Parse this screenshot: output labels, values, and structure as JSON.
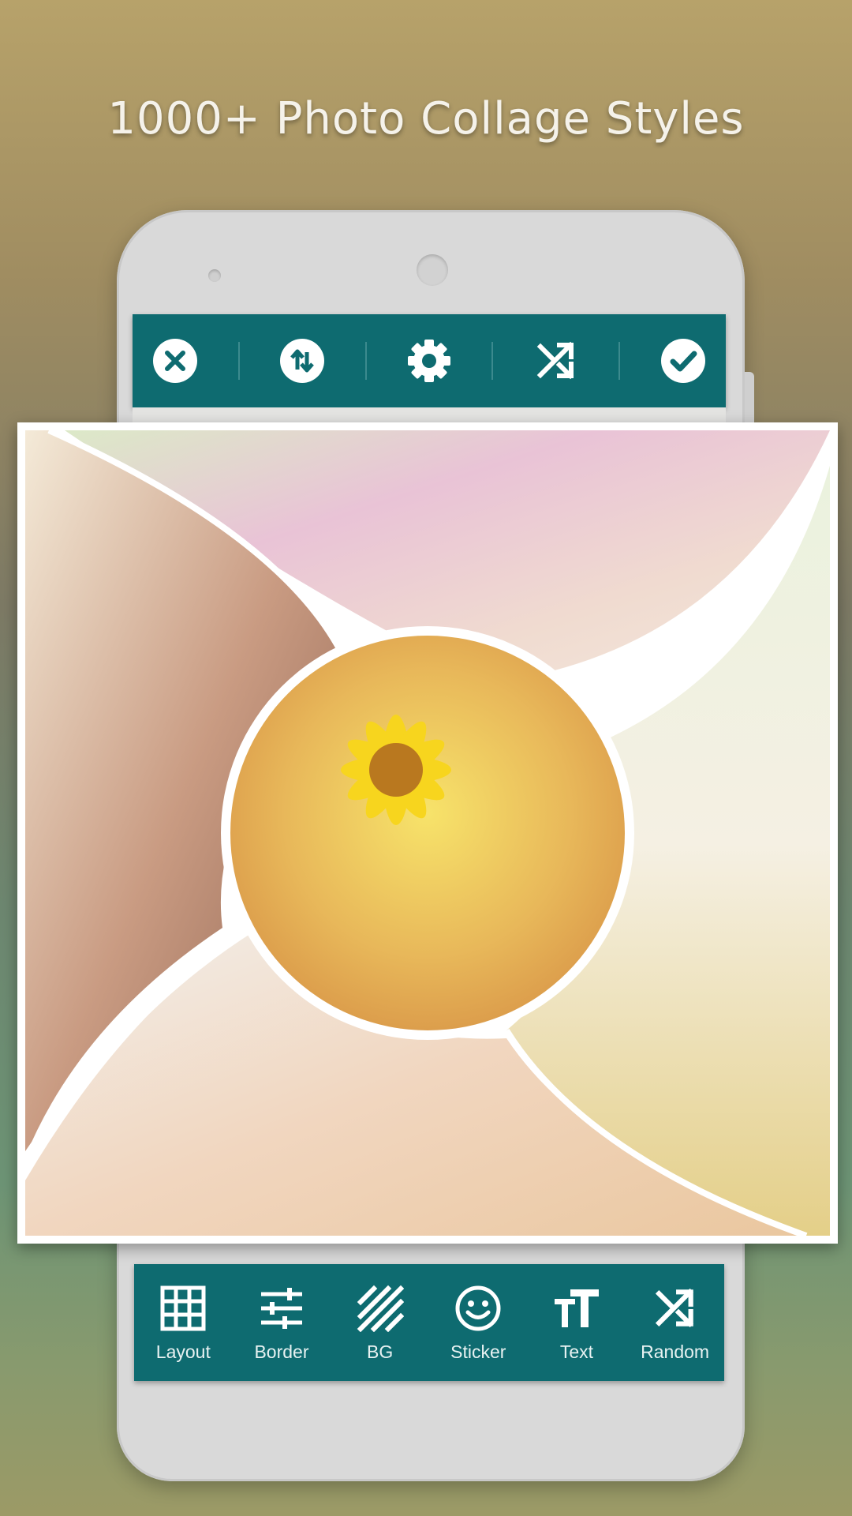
{
  "headline": "1000+ Photo Collage Styles",
  "colors": {
    "toolbar": "#0e6b70",
    "phone_body": "#d9d9d9",
    "frame": "#ffffff"
  },
  "top_toolbar": [
    {
      "icon": "close-circle-icon"
    },
    {
      "icon": "swap-vertical-icon"
    },
    {
      "icon": "gear-icon"
    },
    {
      "icon": "shuffle-icon"
    },
    {
      "icon": "check-circle-icon"
    }
  ],
  "collage_photos": [
    {
      "icon": "photo-girl-flower-crown"
    },
    {
      "icon": "photo-girl-pink-blossoms"
    },
    {
      "icon": "photo-girl-meadow"
    },
    {
      "icon": "photo-girl-blonde-closeup"
    },
    {
      "icon": "photo-girl-sunflower"
    }
  ],
  "bottom_toolbar": [
    {
      "label": "Layout",
      "icon": "grid-icon"
    },
    {
      "label": "Border",
      "icon": "sliders-icon"
    },
    {
      "label": "BG",
      "icon": "stripes-icon"
    },
    {
      "label": "Sticker",
      "icon": "smiley-icon"
    },
    {
      "label": "Text",
      "icon": "text-size-icon"
    },
    {
      "label": "Random",
      "icon": "shuffle-icon"
    }
  ]
}
